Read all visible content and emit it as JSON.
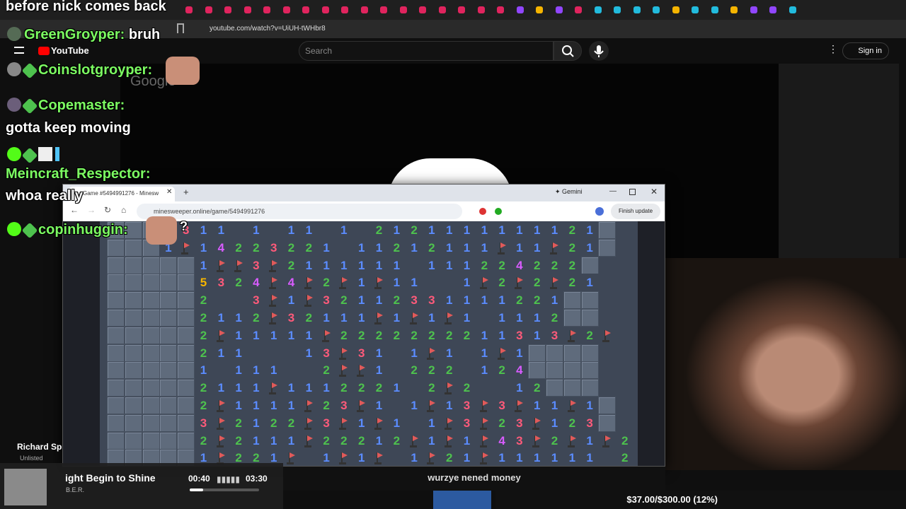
{
  "stream_title": "before nick comes back",
  "browser": {
    "url": "youtube.com/watch?v=UiUH-tWHbr8"
  },
  "youtube": {
    "logo": "YouTube",
    "search_placeholder": "Search",
    "sign_in": "Sign in"
  },
  "overlay_text": {
    "google": "Google"
  },
  "chat": [
    {
      "user": "GreenGroyper:",
      "message": "bruh"
    },
    {
      "user": "Coinslotgroyper:",
      "message": ""
    },
    {
      "user": "Copemaster:",
      "message": "gotta keep moving"
    },
    {
      "user": "Meincraft_Respector:",
      "message": "whoa really"
    },
    {
      "user": "copinhuggin:",
      "message": "?"
    }
  ],
  "minesweeper_window": {
    "tab_title": "Game #5494991276 - Minesw",
    "url": "minesweeper.online/game/5494991276",
    "gemini_label": "Gemini",
    "finish_update": "Finish update"
  },
  "board": {
    "rows": [
      "???4311.1.11.1.2121111111121?",
      "???1F14223221.11212111F11F21?",
      "?????1FF3F2111111.111224222?",
      "?????5324F4F2F1F11..1F2F2F21",
      "?????2..3F1F32112331111221??",
      "?????2112F32111F1F1F1.1112??",
      "?????2F11111F2222222211313F2F",
      "?????211...13F31.1F1.1F1????",
      "?????1.111..2FF1.222.124????",
      "?????2111F1112221.2F2..12???",
      "?????2F1111F23F1.1F13F3F11F1?",
      "?????3F2122F3F1F1.1F3F23F123?",
      "?????2F2111F22212F1F1F43F2F1F212",
      "?????1F221F.1F1F.1F21F111111.2"
    ],
    "colors": {
      "1": "#5b8cff",
      "2": "#4ec24e",
      "3": "#ff5a7a",
      "4": "#d85cff",
      "5": "#f5b400",
      "F": "#e05a5a"
    }
  },
  "music": {
    "song": "ight Begin to Shine",
    "artist": "B.E.R.",
    "time_current": "00:40",
    "time_total": "03:30",
    "progress": 0.19
  },
  "subtitle": "wurzye nened money",
  "goal": "$37.00/$300.00 (12%)",
  "channel": {
    "name": "Richard Sp",
    "visibility": "Unlisted"
  }
}
